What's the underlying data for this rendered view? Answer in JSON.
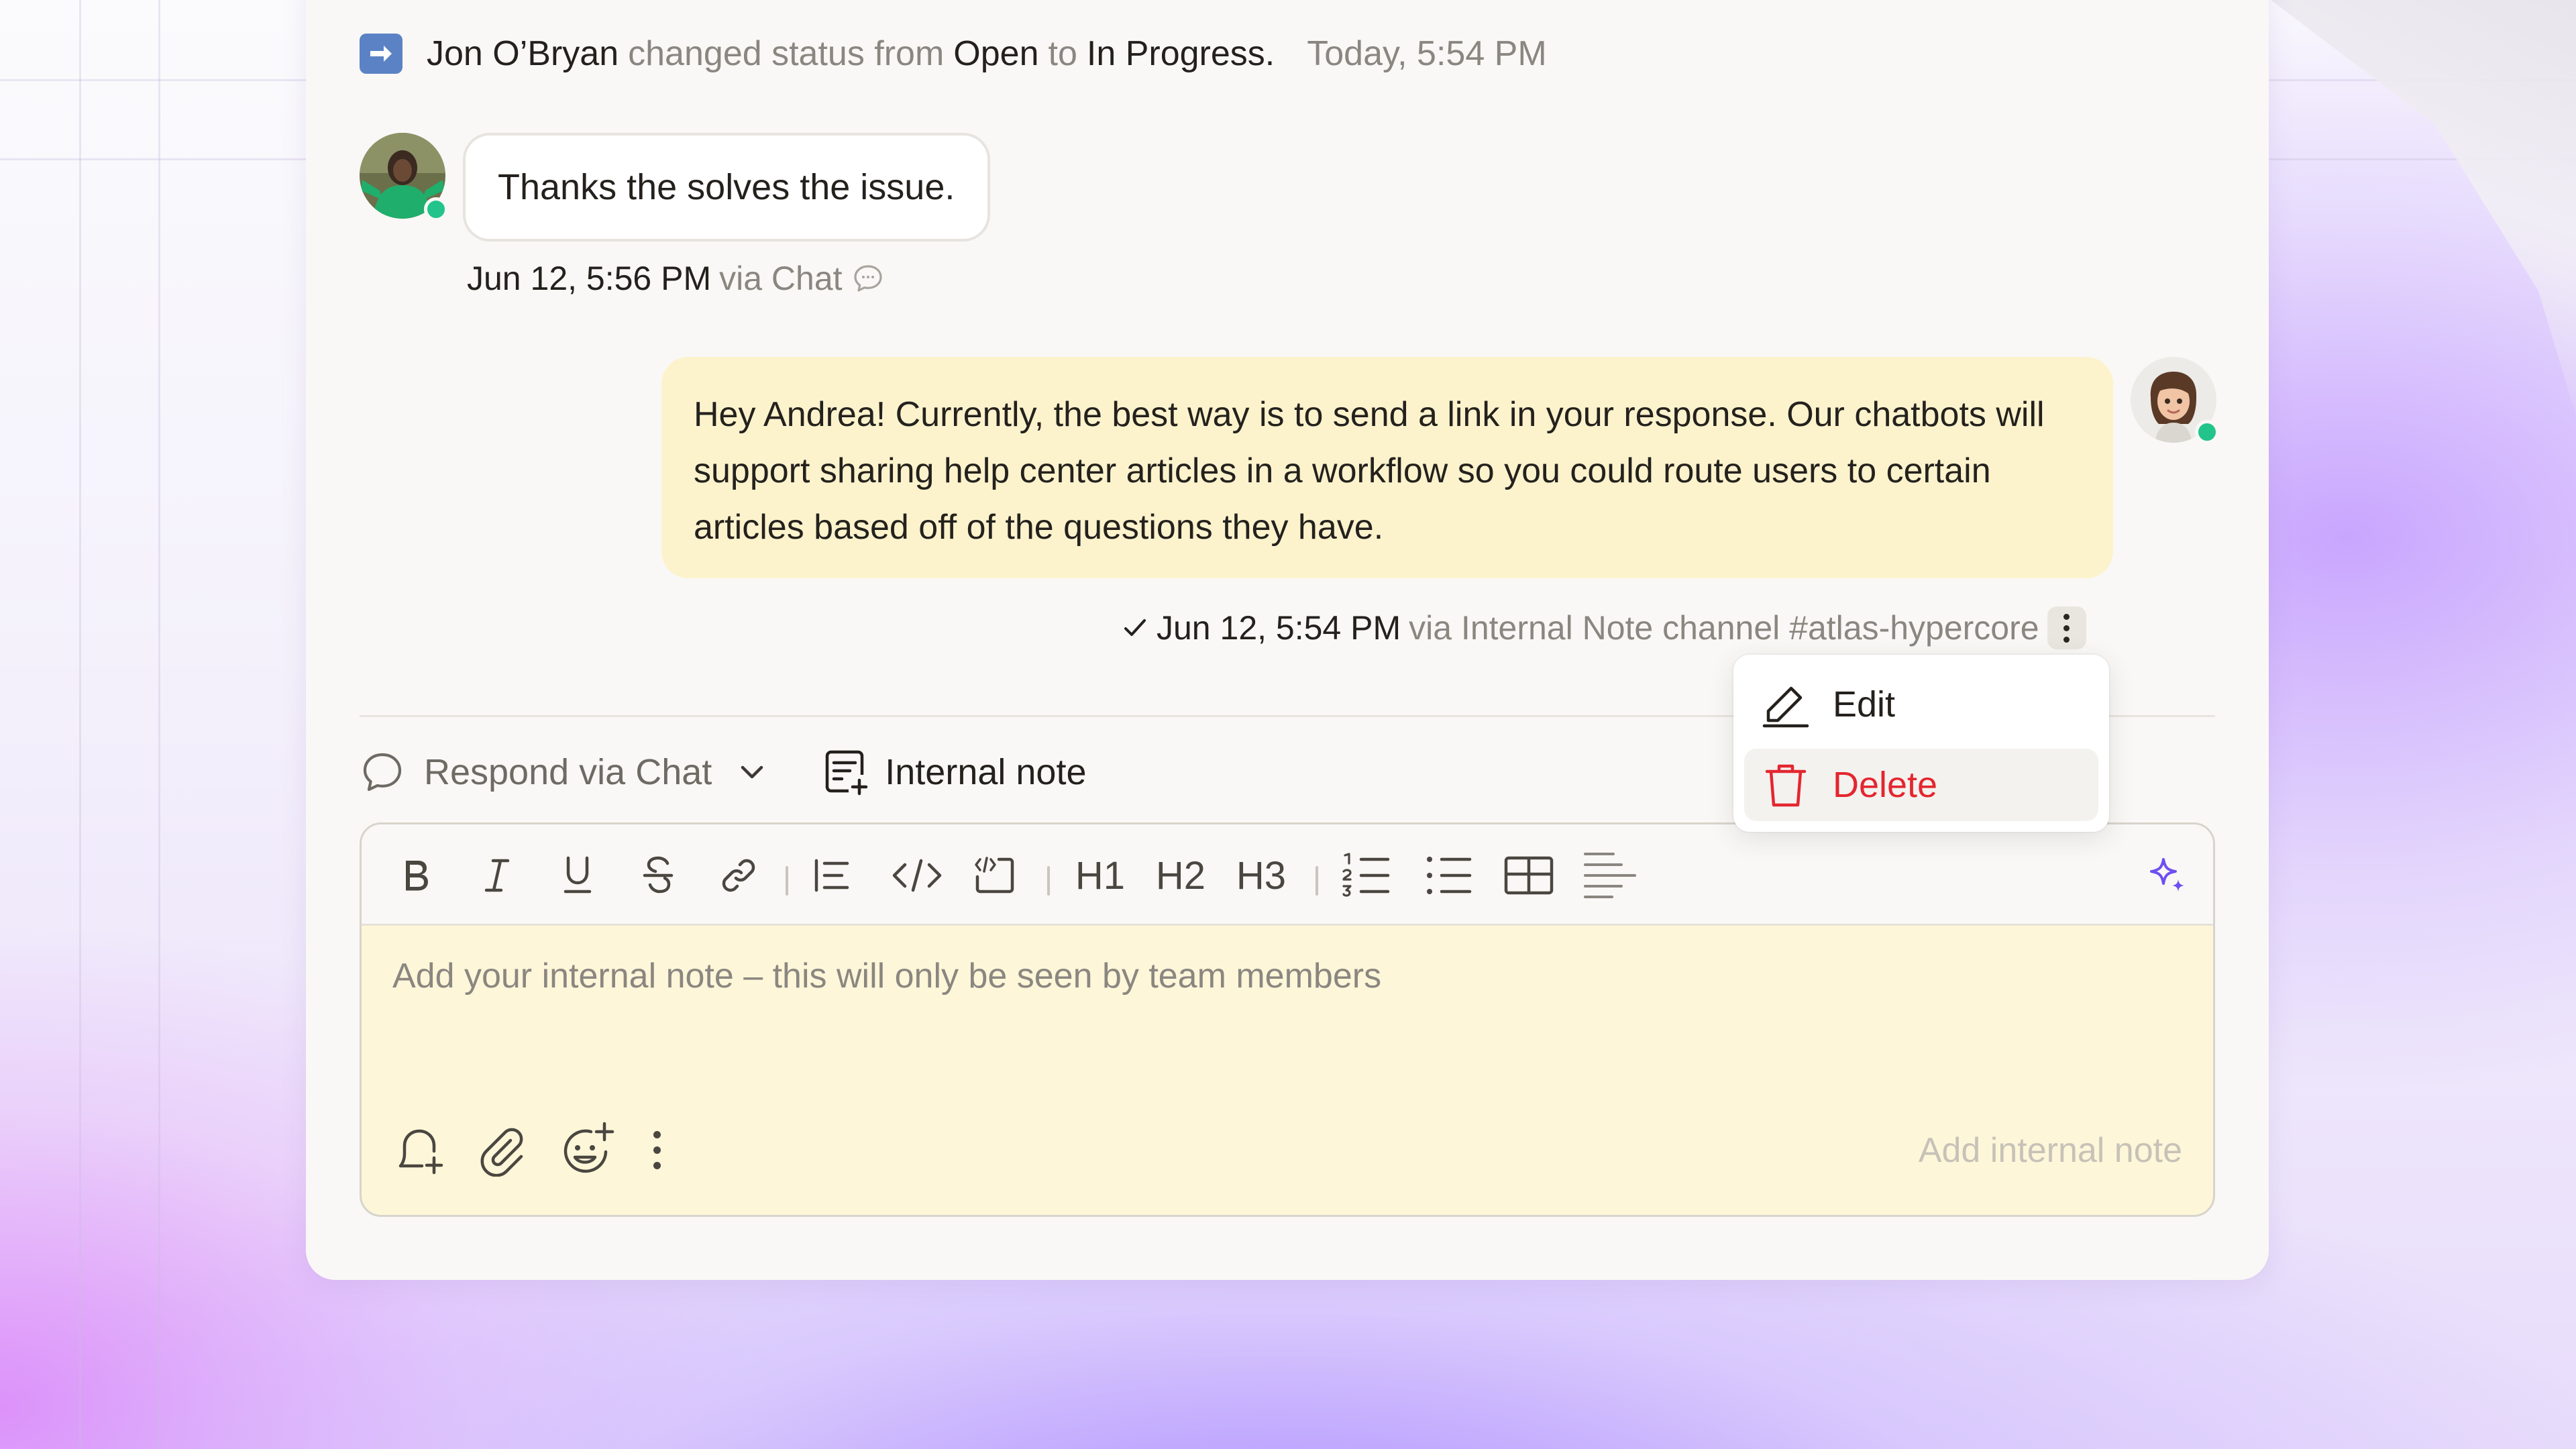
{
  "activity": {
    "actor": "Jon O’Bryan",
    "action": "changed status from",
    "from_status": "Open",
    "to_word": "to",
    "to_status": "In Progress.",
    "time": "Today, 5:54 PM"
  },
  "message_in": {
    "text": "Thanks the solves the issue.",
    "timestamp": "Jun 12, 5:56 PM",
    "via": "via Chat"
  },
  "message_out": {
    "text": "Hey Andrea! Currently, the best way is to send a link in your response. Our chatbots will support sharing help center articles in a workflow so you could route users to certain articles based off of the questions they have.",
    "timestamp": "Jun 12, 5:54 PM",
    "via": "via Internal Note channel #atlas-hypercore"
  },
  "context_menu": {
    "edit_label": "Edit",
    "delete_label": "Delete"
  },
  "composer": {
    "respond_label": "Respond via Chat",
    "internal_note_label": "Internal note",
    "placeholder": "Add your internal note – this will only be seen by team members",
    "submit_label": "Add internal note",
    "toolbar": [
      "bold",
      "italic",
      "underline",
      "strikethrough",
      "link",
      "blockquote",
      "code",
      "code-block",
      "h1",
      "h2",
      "h3",
      "ordered-list",
      "bullet-list",
      "table",
      "align",
      "ai-sparkle"
    ],
    "h1": "H1",
    "h2": "H2",
    "h3": "H3"
  },
  "colors": {
    "note_bg": "#fcf3cd",
    "delete_red": "#e4262f",
    "online_green": "#22c48a",
    "ai_purple": "#6d4ff2"
  }
}
